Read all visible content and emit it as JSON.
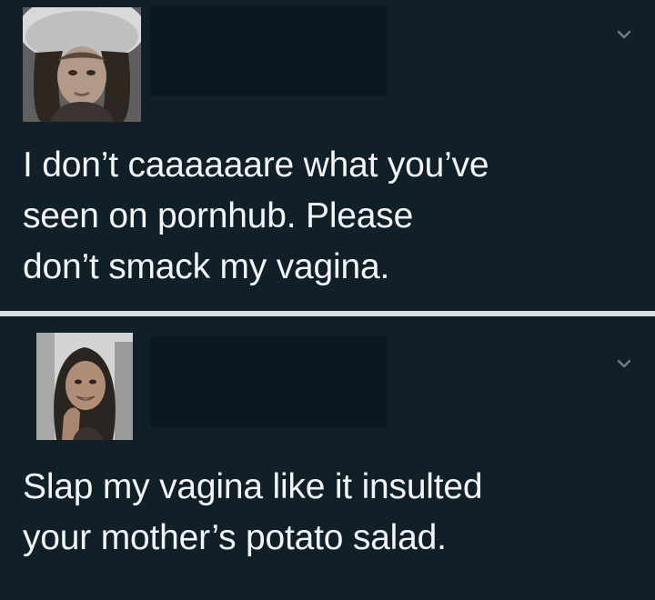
{
  "posts": [
    {
      "text": "I don’t caaaaaare what you’ve\nseen on pornhub.  Please\ndon’t smack my vagina."
    },
    {
      "text": "Slap my vagina like it insulted\nyour mother’s potato salad."
    }
  ],
  "icons": {
    "menu": "chevron-down-icon"
  },
  "colors": {
    "background": "#111f29",
    "text": "#f2f4f6",
    "divider": "#d9dde0",
    "chevron": "#6f7d88"
  }
}
